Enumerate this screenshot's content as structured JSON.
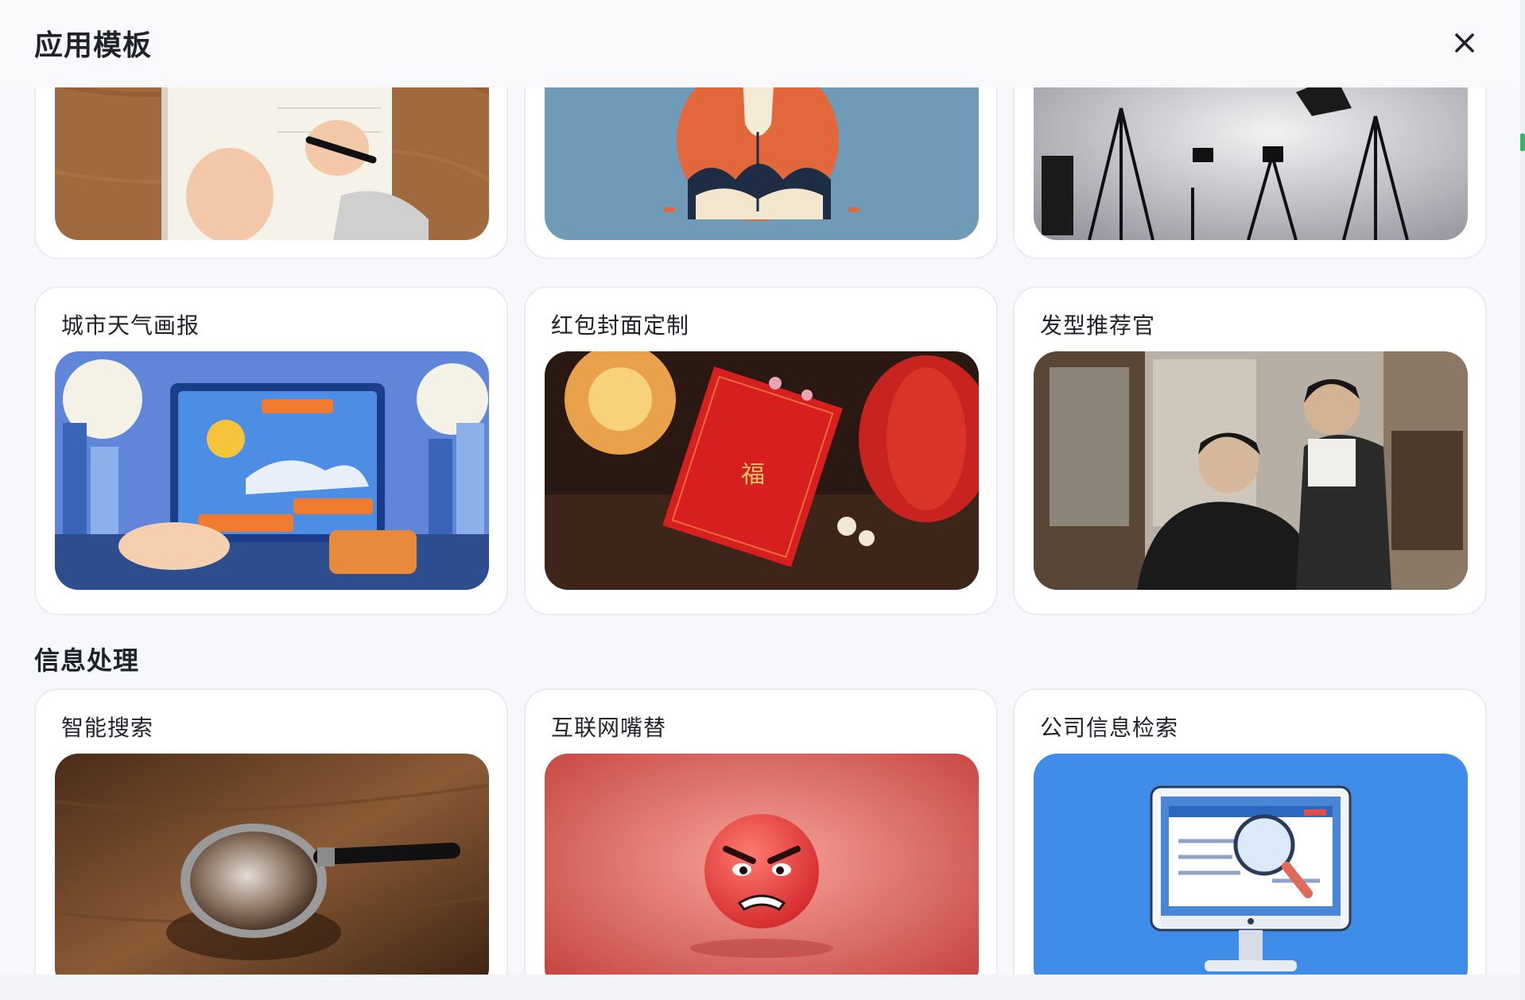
{
  "modal": {
    "title": "应用模板",
    "close_icon": "close-icon"
  },
  "sections": [
    {
      "title": "",
      "cards": [
        {
          "title": "",
          "image": "notebook-writing-image"
        },
        {
          "title": "",
          "image": "lightbulb-illustration-image"
        },
        {
          "title": "",
          "image": "photo-studio-image"
        }
      ]
    },
    {
      "title": "",
      "cards": [
        {
          "title": "城市天气画报",
          "image": "city-weather-poster-image"
        },
        {
          "title": "红包封面定制",
          "image": "red-envelope-image"
        },
        {
          "title": "发型推荐官",
          "image": "barber-shop-image"
        }
      ]
    },
    {
      "title": "信息处理",
      "cards": [
        {
          "title": "智能搜索",
          "image": "magnifier-on-wood-image"
        },
        {
          "title": "互联网嘴替",
          "image": "angry-face-image"
        },
        {
          "title": "公司信息检索",
          "image": "monitor-search-image"
        }
      ]
    }
  ],
  "colors": {
    "background": "#f7f8fb",
    "card_border": "#e9ebf0",
    "text": "#1f2329",
    "accent_green": "#36b36b"
  }
}
